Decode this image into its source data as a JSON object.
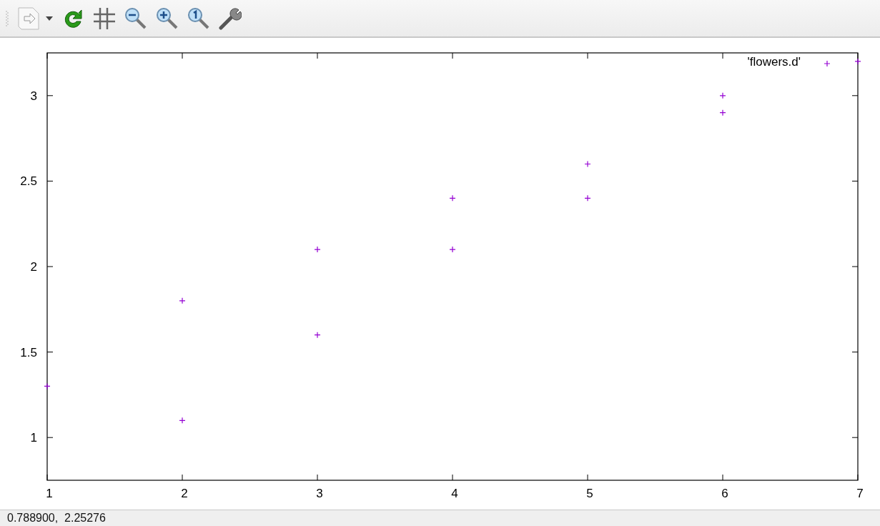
{
  "plot": {
    "chart_data": {
      "type": "scatter",
      "x": [
        1,
        2,
        2,
        3,
        3,
        4,
        4,
        5,
        5,
        6,
        6,
        7
      ],
      "series": [
        {
          "name": "'flowers.d'",
          "color": "#9400d3",
          "values": [
            1.3,
            1.8,
            1.1,
            2.1,
            1.6,
            2.4,
            2.1,
            2.6,
            2.4,
            3.0,
            2.9,
            3.2
          ]
        }
      ],
      "xlim": [
        1,
        7
      ],
      "ylim": [
        0.75,
        3.25
      ],
      "xticks": [
        1,
        2,
        3,
        4,
        5,
        6,
        7
      ],
      "yticks": [
        1,
        1.5,
        2,
        2.5,
        3
      ]
    }
  },
  "status_bar": {
    "text": "0.788900,  2.25276"
  }
}
